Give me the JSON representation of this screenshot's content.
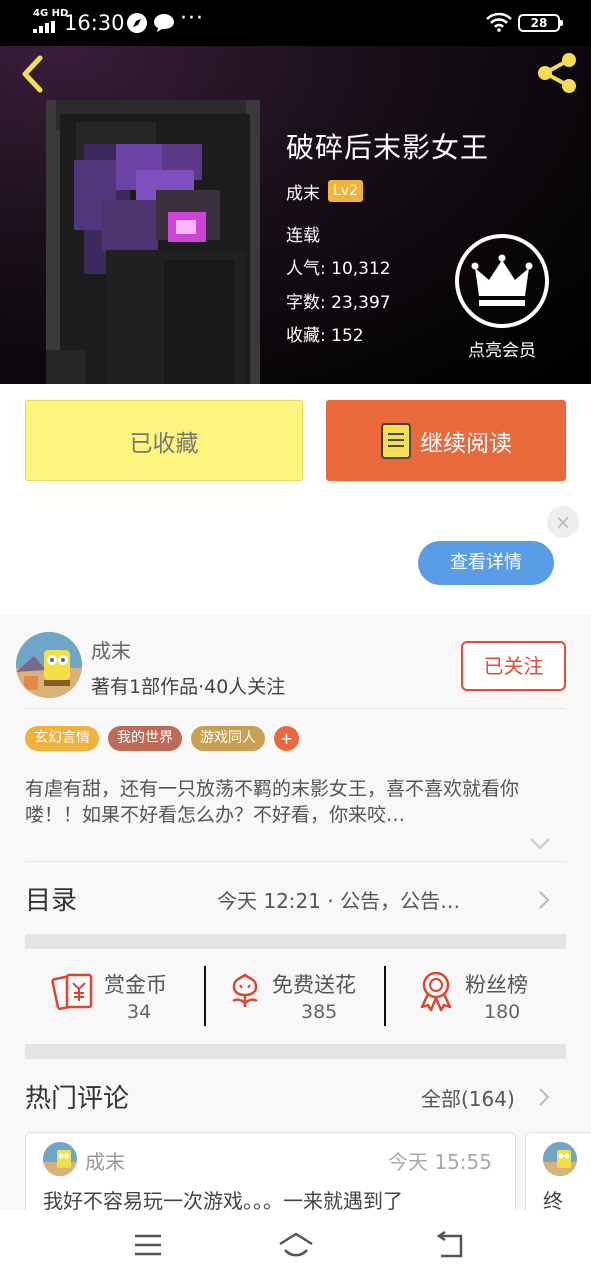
{
  "status_bar": {
    "network": "4G HD",
    "time": "16:30",
    "more": "···",
    "battery": "28"
  },
  "book": {
    "title": "破碎后末影女王",
    "author": "成末",
    "level": "Lv2",
    "status": "连载",
    "popularity_label": "人气:",
    "popularity": "10,312",
    "words_label": "字数:",
    "words": "23,397",
    "favorites_label": "收藏:",
    "favorites": "152",
    "vip_label": "点亮会员"
  },
  "actions": {
    "favorited": "已收藏",
    "continue_reading": "继续阅读"
  },
  "ad": {
    "close": "×",
    "detail_button": "查看详情"
  },
  "author": {
    "name": "成末",
    "works_info": "著有1部作品·40人关注",
    "follow_button": "已关注"
  },
  "tags": [
    {
      "label": "玄幻言情",
      "color": "#f0b23a"
    },
    {
      "label": "我的世界",
      "color": "#c06a58"
    },
    {
      "label": "游戏同人",
      "color": "#c7a052"
    },
    {
      "label": "+",
      "color": "#e9693d"
    }
  ],
  "description": "有虐有甜，还有一只放荡不羁的末影女王，喜不喜欢就看你喽！！如果不好看怎么办？不好看，你来咬…",
  "toc": {
    "label": "目录",
    "latest": "今天 12:21 · 公告，公告…"
  },
  "stats": [
    {
      "label": "赏金币",
      "value": "34",
      "icon": "red-envelope-icon"
    },
    {
      "label": "免费送花",
      "value": "385",
      "icon": "flower-icon"
    },
    {
      "label": "粉丝榜",
      "value": "180",
      "icon": "medal-icon"
    }
  ],
  "hot_comments": {
    "title": "热门评论",
    "all_label": "全部(164)",
    "items": [
      {
        "user": "成末",
        "time": "今天 15:55",
        "text": "我好不容易玩一次游戏。。。一来就遇到了"
      },
      {
        "user": "",
        "time": "",
        "text": "终"
      }
    ]
  },
  "colors": {
    "accent_orange": "#e9693d",
    "favorite_yellow": "#fef57e",
    "follow_red": "#e14f3a",
    "detail_blue": "#5a9de6",
    "level_badge": "#f0b437"
  }
}
